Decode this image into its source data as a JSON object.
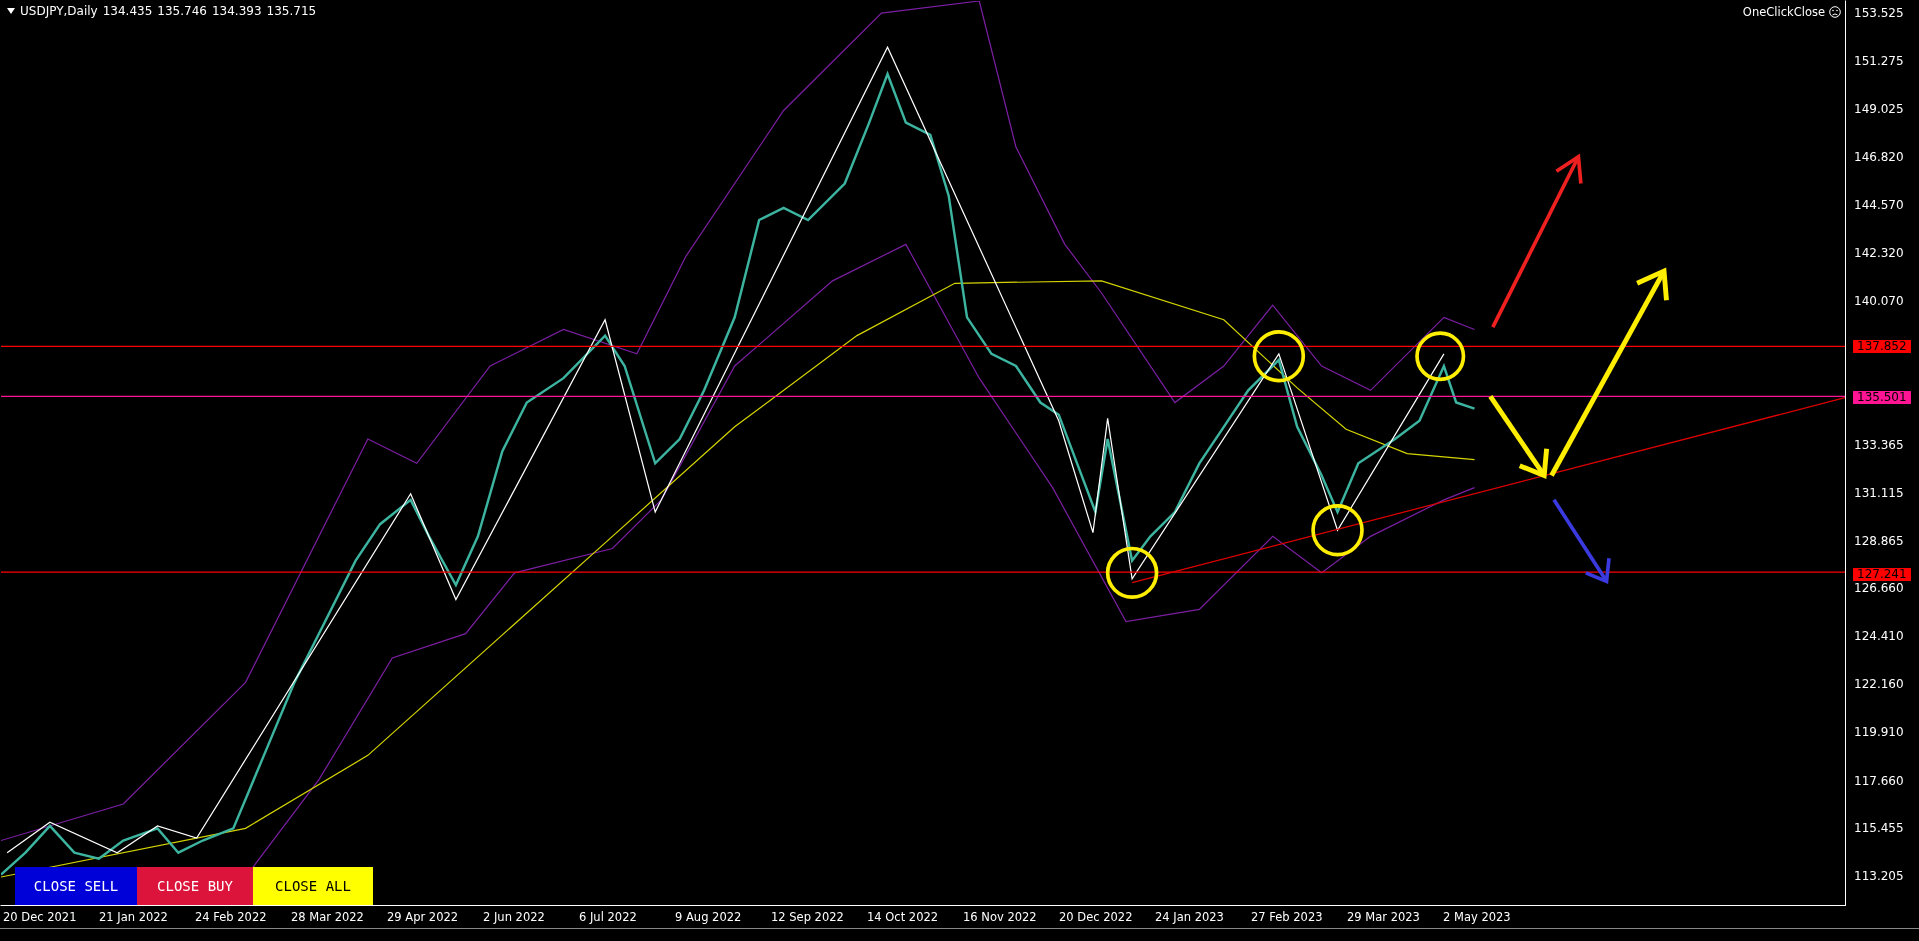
{
  "symbol": {
    "title": "USDJPY,Daily",
    "ohlc": [
      "134.435",
      "135.746",
      "134.393",
      "135.715"
    ]
  },
  "expert": {
    "name": "OneClickClose"
  },
  "price_axis": [
    "153.525",
    "151.275",
    "149.025",
    "146.820",
    "144.570",
    "142.320",
    "140.070",
    "133.365",
    "131.115",
    "128.865",
    "126.660",
    "124.410",
    "122.160",
    "119.910",
    "117.660",
    "115.455",
    "113.205"
  ],
  "price_lines": [
    {
      "label": "137.852",
      "color": "#ff0000"
    },
    {
      "label": "135.501",
      "color": "#ff1493"
    },
    {
      "label": "127.241",
      "color": "#ff0000"
    }
  ],
  "buttons": [
    {
      "label": "CLOSE SELL",
      "kind": "sell"
    },
    {
      "label": "CLOSE BUY",
      "kind": "buy"
    },
    {
      "label": "CLOSE ALL",
      "kind": "all"
    }
  ],
  "date_axis": [
    "20 Dec 2021",
    "21 Jan 2022",
    "24 Feb 2022",
    "28 Mar 2022",
    "29 Apr 2022",
    "2 Jun 2022",
    "6 Jul 2022",
    "9 Aug 2022",
    "12 Sep 2022",
    "14 Oct 2022",
    "16 Nov 2022",
    "20 Dec 2022",
    "24 Jan 2023",
    "27 Feb 2023",
    "29 Mar 2023",
    "2 May 2023"
  ]
}
